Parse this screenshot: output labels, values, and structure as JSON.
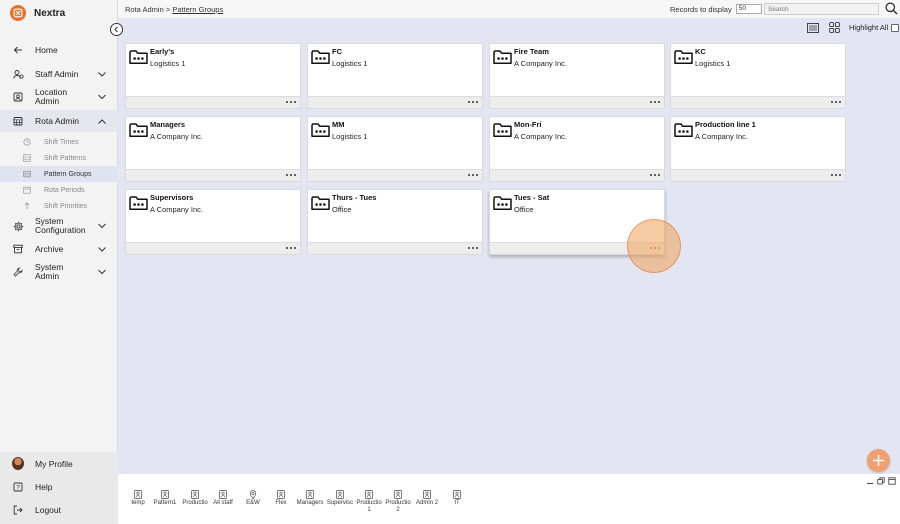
{
  "app": {
    "name": "Nextra"
  },
  "sidebar": {
    "items": [
      {
        "label": "Home",
        "icon": "arrow-left-icon"
      },
      {
        "label": "Staff Admin",
        "icon": "staff-icon"
      },
      {
        "label": "Location Admin",
        "icon": "location-icon"
      },
      {
        "label": "Rota Admin",
        "icon": "calendar-icon"
      },
      {
        "label": "System Configuration",
        "icon": "gear-icon"
      },
      {
        "label": "Archive",
        "icon": "archive-icon"
      },
      {
        "label": "System Admin",
        "icon": "wrench-icon"
      }
    ],
    "subitems": [
      {
        "label": "Shift Times"
      },
      {
        "label": "Shift Patterns"
      },
      {
        "label": "Pattern Groups"
      },
      {
        "label": "Rota Periods"
      },
      {
        "label": "Shift Priorities"
      }
    ],
    "bottom": [
      {
        "label": "My Profile"
      },
      {
        "label": "Help"
      },
      {
        "label": "Logout"
      }
    ]
  },
  "breadcrumb": {
    "parent": "Rota Admin",
    "separator": ">",
    "current": "Pattern Groups"
  },
  "toolbar": {
    "records_label": "Records to display",
    "records_value": "50",
    "search_placeholder": "Search",
    "highlight_label": "Highlight All"
  },
  "cards": [
    {
      "title": "Early's",
      "subtitle": "Logistics 1"
    },
    {
      "title": "FC",
      "subtitle": "Logistics 1"
    },
    {
      "title": "Fire Team",
      "subtitle": "A Company Inc."
    },
    {
      "title": "KC",
      "subtitle": "Logistics 1"
    },
    {
      "title": "Managers",
      "subtitle": "A Company Inc."
    },
    {
      "title": "MM",
      "subtitle": "Logistics 1"
    },
    {
      "title": "Mon-Fri",
      "subtitle": "A Company Inc."
    },
    {
      "title": "Production line 1",
      "subtitle": "A Company Inc."
    },
    {
      "title": "Supervisors",
      "subtitle": "A Company Inc."
    },
    {
      "title": "Thurs - Tues",
      "subtitle": "Office"
    },
    {
      "title": "Tues - Sat",
      "subtitle": "Office"
    }
  ],
  "tray": {
    "tabs": [
      {
        "label": "temp",
        "icon": "person-icon"
      },
      {
        "label": "Pattern1",
        "icon": "person-icon"
      },
      {
        "label": "Productio",
        "icon": "person-icon"
      },
      {
        "label": "All staff",
        "icon": "person-icon"
      },
      {
        "label": "E&W",
        "icon": "pin-icon"
      },
      {
        "label": "Flex",
        "icon": "person-icon"
      },
      {
        "label": "Managers",
        "icon": "person-icon"
      },
      {
        "label": "Supervisc",
        "icon": "person-icon"
      },
      {
        "label": "Productio 1",
        "icon": "person-icon"
      },
      {
        "label": "Productio 2",
        "icon": "person-icon"
      },
      {
        "label": "Admin 2",
        "icon": "person-icon"
      },
      {
        "label": "IT",
        "icon": "person-icon"
      }
    ]
  },
  "colors": {
    "accent": "#e8702a",
    "background": "#e3e6f2",
    "sidebar": "#f3f3f3"
  }
}
